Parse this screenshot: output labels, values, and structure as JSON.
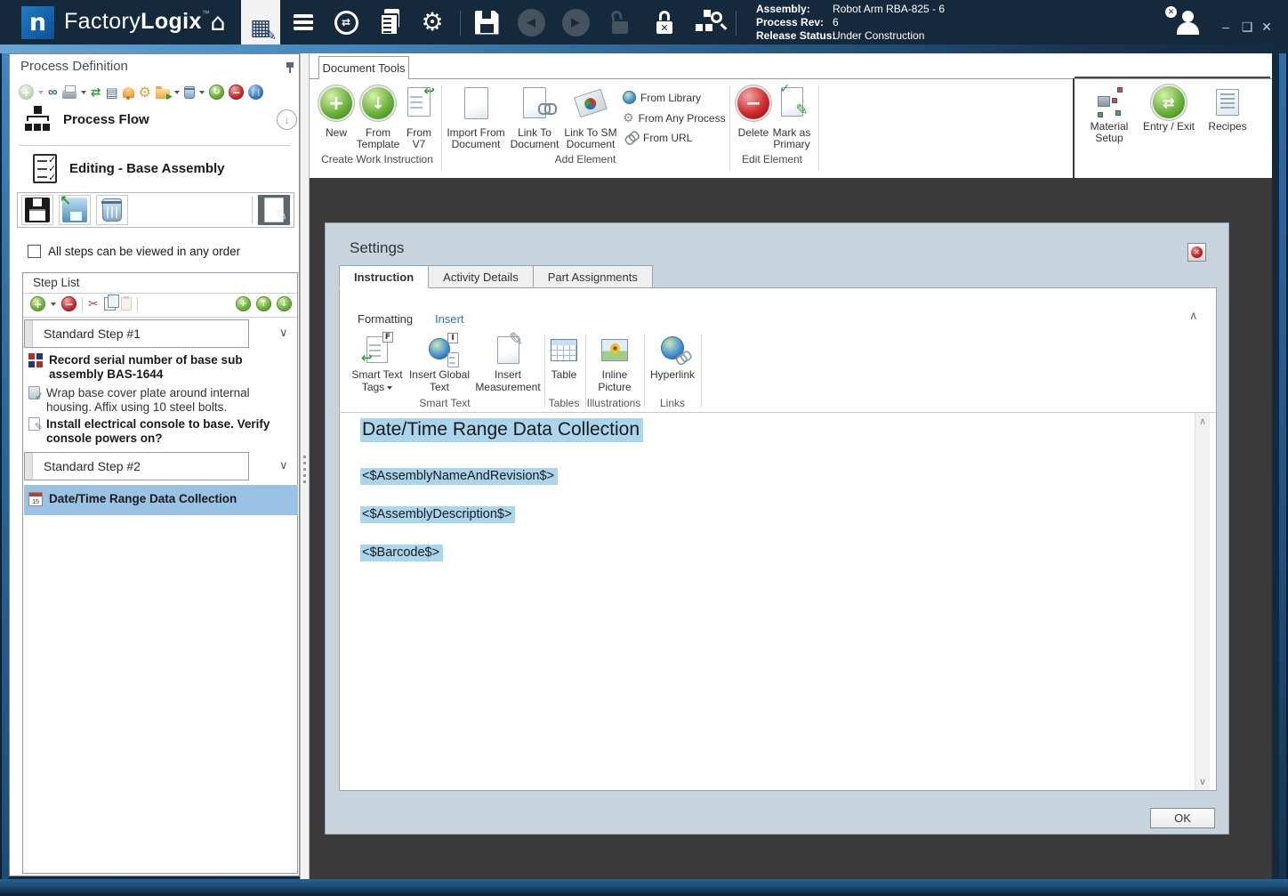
{
  "titlebar": {
    "brand": {
      "part1": "Factory",
      "part2": "Logix",
      "tm": "™"
    },
    "info": {
      "assembly_label": "Assembly:",
      "assembly_value": "Robot Arm RBA-825 - 6",
      "rev_label": "Process Rev:",
      "rev_value": "6",
      "status_label": "Release Status:",
      "status_value": "Under Construction"
    },
    "icons": [
      "home",
      "design",
      "production",
      "distribution",
      "reports",
      "settings",
      "save",
      "back",
      "forward",
      "unlock",
      "lock-cancel",
      "process-search",
      "user",
      "minimize",
      "maximize",
      "close"
    ]
  },
  "sidebar": {
    "title": "Process Definition",
    "toolbar_icons": [
      "add",
      "find",
      "print",
      "assign",
      "presentation",
      "alert",
      "configure",
      "run",
      "delete",
      "refresh",
      "remove",
      "pause"
    ],
    "process_flow_label": "Process Flow",
    "editing_label": "Editing - Base Assembly",
    "save_toolbar_icons": [
      "save",
      "save-import",
      "discard",
      "edit-mode"
    ],
    "any_order_label": "All steps can be viewed in any order",
    "step_list": {
      "title": "Step List",
      "toolbar_icons": [
        "add-step",
        "remove-step",
        "cut",
        "copy",
        "paste",
        "insert-step",
        "move-up",
        "move-down"
      ],
      "items": [
        {
          "type": "step-header",
          "label": "Standard Step #1"
        },
        {
          "type": "activity",
          "icon": "data-entry-icon",
          "bold": true,
          "text": "Record serial number of base sub assembly BAS-1644"
        },
        {
          "type": "activity",
          "icon": "work-instruction-icon",
          "bold": false,
          "text": "Wrap base cover plate around internal housing. Affix using 10 steel bolts."
        },
        {
          "type": "activity",
          "icon": "form-icon",
          "bold": true,
          "text": "Install electrical console to base. Verify console powers on?"
        },
        {
          "type": "step-header",
          "label": "Standard Step #2"
        },
        {
          "type": "activity",
          "icon": "calendar-icon",
          "bold": true,
          "selected": true,
          "text": "Date/Time Range Data Collection"
        }
      ]
    }
  },
  "ribbon": {
    "tab_label": "Document Tools",
    "create_group": {
      "label": "Create Work Instruction",
      "new": "New",
      "from_template": "From Template",
      "from_v7": "From V7"
    },
    "add_group": {
      "label": "Add Element",
      "import_from_document": "Import From Document",
      "link_to_document": "Link To Document",
      "link_to_sm_document": "Link To SM Document",
      "from_library": "From Library",
      "from_any_process": "From Any Process",
      "from_url": "From URL"
    },
    "edit_group": {
      "label": "Edit Element",
      "delete": "Delete",
      "mark_as_primary": "Mark as Primary"
    },
    "right_buttons": {
      "material_setup": "Material Setup",
      "entry_exit": "Entry / Exit",
      "recipes": "Recipes"
    }
  },
  "settings_dialog": {
    "title": "Settings",
    "tabs": [
      "Instruction",
      "Activity Details",
      "Part Assignments"
    ],
    "editor_tabs": {
      "formatting": "Formatting",
      "insert": "Insert"
    },
    "insert_ribbon": {
      "smart_text_tags": "Smart Text Tags",
      "insert_global_text": "Insert Global Text",
      "insert_measurement": "Insert Measurement",
      "table": "Table",
      "inline_picture": "Inline Picture",
      "hyperlink": "Hyperlink",
      "groups": {
        "smart_text": "Smart Text",
        "tables": "Tables",
        "illustrations": "Illustrations",
        "links": "Links"
      }
    },
    "document": {
      "heading": "Date/Time Range Data Collection",
      "lines": [
        "<$AssemblyNameAndRevision$>",
        "<$AssemblyDescription$>",
        "<$Barcode$>"
      ]
    },
    "ok_label": "OK"
  },
  "colors": {
    "titlebar": "#15293c",
    "accent_blue": "#4a8cc0",
    "workspace": "#3a3a3a",
    "dialog_bg": "#c7d3dd",
    "selection": "#9ac2e4",
    "text_highlight": "#abd5ec"
  }
}
